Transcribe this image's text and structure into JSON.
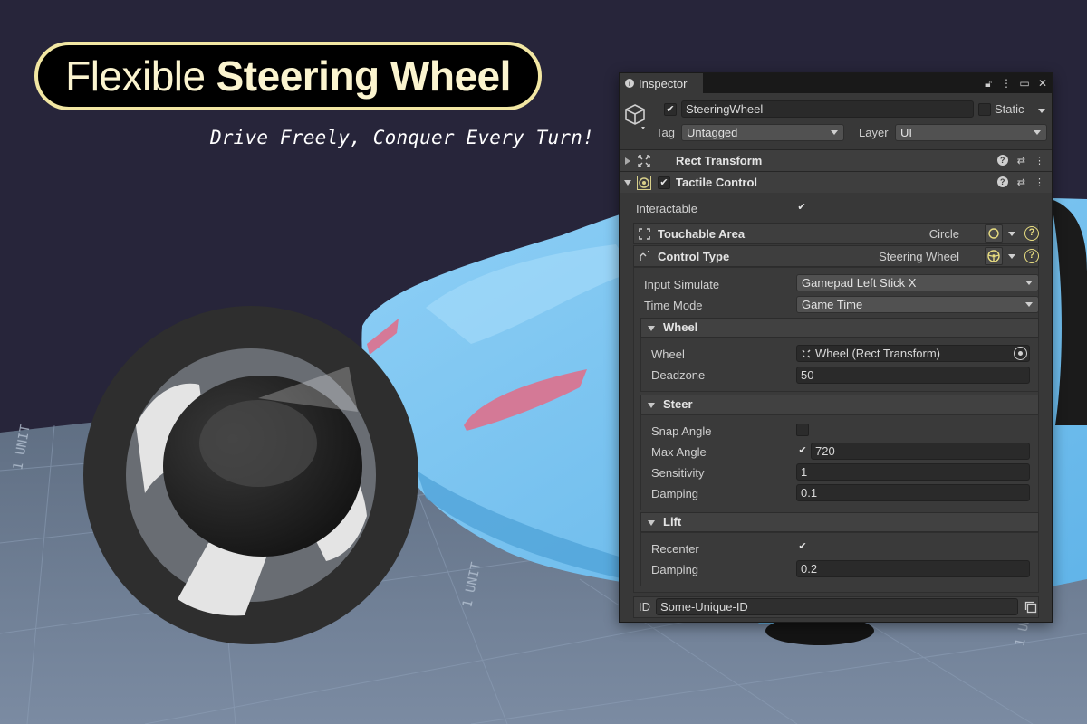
{
  "headline": {
    "title_light": "Flexible",
    "title_bold": "Steering Wheel",
    "tagline": "Drive Freely, Conquer Every Turn!"
  },
  "floor": {
    "label": "1 UNIT"
  },
  "colors": {
    "background": "#27253a",
    "title_border": "#f2e7a3",
    "car_body": "#7cc4f2",
    "floor": "#6c7c92",
    "accent_yellow": "#e8dd80"
  },
  "inspector": {
    "tab_label": "Inspector",
    "tab_icons": [
      "lock-icon",
      "more-icon",
      "maximize-icon",
      "close-icon"
    ],
    "object": {
      "active_checked": true,
      "name": "SteeringWheel",
      "static_label": "Static",
      "static_checked": false,
      "tag_label": "Tag",
      "tag_value": "Untagged",
      "layer_label": "Layer",
      "layer_value": "UI"
    },
    "components": [
      {
        "name": "Rect Transform",
        "expanded": false
      },
      {
        "name": "Tactile Control",
        "expanded": true,
        "enabled": true
      }
    ],
    "tactile": {
      "interactable_label": "Interactable",
      "interactable_checked": true,
      "touchable_area": {
        "label": "Touchable Area",
        "value": "Circle"
      },
      "control_type": {
        "label": "Control Type",
        "value": "Steering Wheel"
      },
      "input_simulate": {
        "label": "Input Simulate",
        "value": "Gamepad Left Stick X"
      },
      "time_mode": {
        "label": "Time Mode",
        "value": "Game Time"
      },
      "wheel_section": {
        "title": "Wheel",
        "wheel_label": "Wheel",
        "wheel_value": "Wheel (Rect Transform)",
        "deadzone_label": "Deadzone",
        "deadzone_value": "50"
      },
      "steer_section": {
        "title": "Steer",
        "snap_angle_label": "Snap Angle",
        "snap_angle_checked": false,
        "max_angle_label": "Max Angle",
        "max_angle_checked": true,
        "max_angle_value": "720",
        "sensitivity_label": "Sensitivity",
        "sensitivity_value": "1",
        "damping_label": "Damping",
        "damping_value": "0.1"
      },
      "lift_section": {
        "title": "Lift",
        "recenter_label": "Recenter",
        "recenter_checked": true,
        "damping_label": "Damping",
        "damping_value": "0.2"
      },
      "id_label": "ID",
      "id_value": "Some-Unique-ID"
    }
  }
}
